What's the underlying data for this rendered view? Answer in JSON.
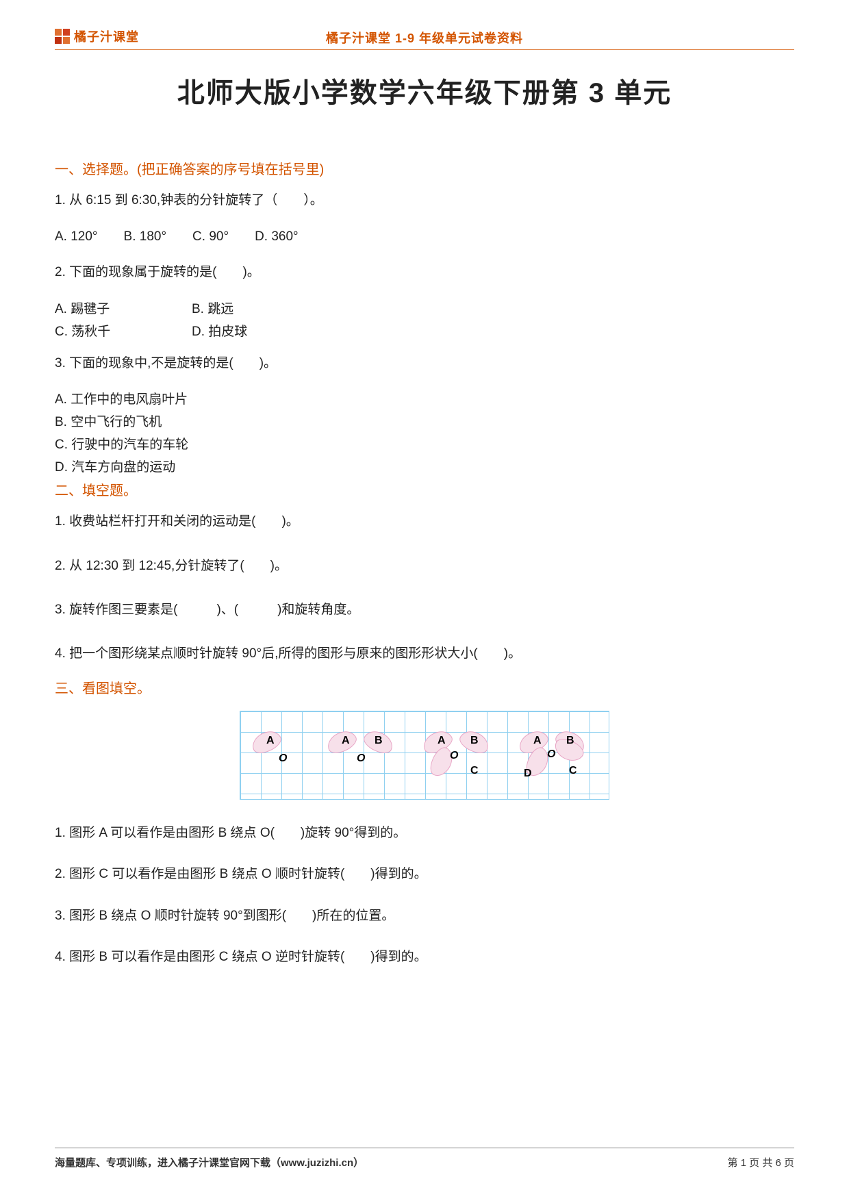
{
  "header": {
    "brand": "橘子汁课堂",
    "center": "橘子汁课堂 1-9 年级单元试卷资料"
  },
  "title": "北师大版小学数学六年级下册第 3 单元",
  "section1": {
    "heading": "一、选择题。(把正确答案的序号填在括号里)",
    "q1": "1. 从 6:15 到 6:30,钟表的分针旋转了（　　）。",
    "q1_opts": "A. 120°　　B. 180°　　C. 90°　　D. 360°",
    "q2": "2. 下面的现象属于旋转的是(　　)。",
    "q2_optA": "A. 踢毽子",
    "q2_optB": "B. 跳远",
    "q2_optC": "C. 荡秋千",
    "q2_optD": "D. 拍皮球",
    "q3": "3. 下面的现象中,不是旋转的是(　　)。",
    "q3_optA": "A. 工作中的电风扇叶片",
    "q3_optB": "B. 空中飞行的飞机",
    "q3_optC": "C. 行驶中的汽车的车轮",
    "q3_optD": "D. 汽车方向盘的运动"
  },
  "section2": {
    "heading": "二、填空题。",
    "q1": "1. 收费站栏杆打开和关闭的运动是(　　)。",
    "q2": "2. 从 12:30 到 12:45,分针旋转了(　　)。",
    "q3": "3. 旋转作图三要素是(　　　)、(　　　)和旋转角度。",
    "q4": "4. 把一个图形绕某点顺时针旋转 90°后,所得的图形与原来的图形形状大小(　　)。"
  },
  "section3": {
    "heading": "三、看图填空。",
    "figure_labels": {
      "A": "A",
      "B": "B",
      "C": "C",
      "D": "D",
      "O": "O"
    },
    "q1": "1. 图形 A 可以看作是由图形 B 绕点 O(　　)旋转 90°得到的。",
    "q2": "2. 图形 C 可以看作是由图形 B 绕点 O 顺时针旋转(　　)得到的。",
    "q3": "3. 图形 B 绕点 O 顺时针旋转 90°到图形(　　)所在的位置。",
    "q4": "4. 图形 B 可以看作是由图形 C 绕点 O 逆时针旋转(　　)得到的。"
  },
  "footer": {
    "left": "海量题库、专项训练，进入橘子汁课堂官网下载（www.juzizhi.cn）",
    "right": "第 1 页 共 6 页"
  }
}
